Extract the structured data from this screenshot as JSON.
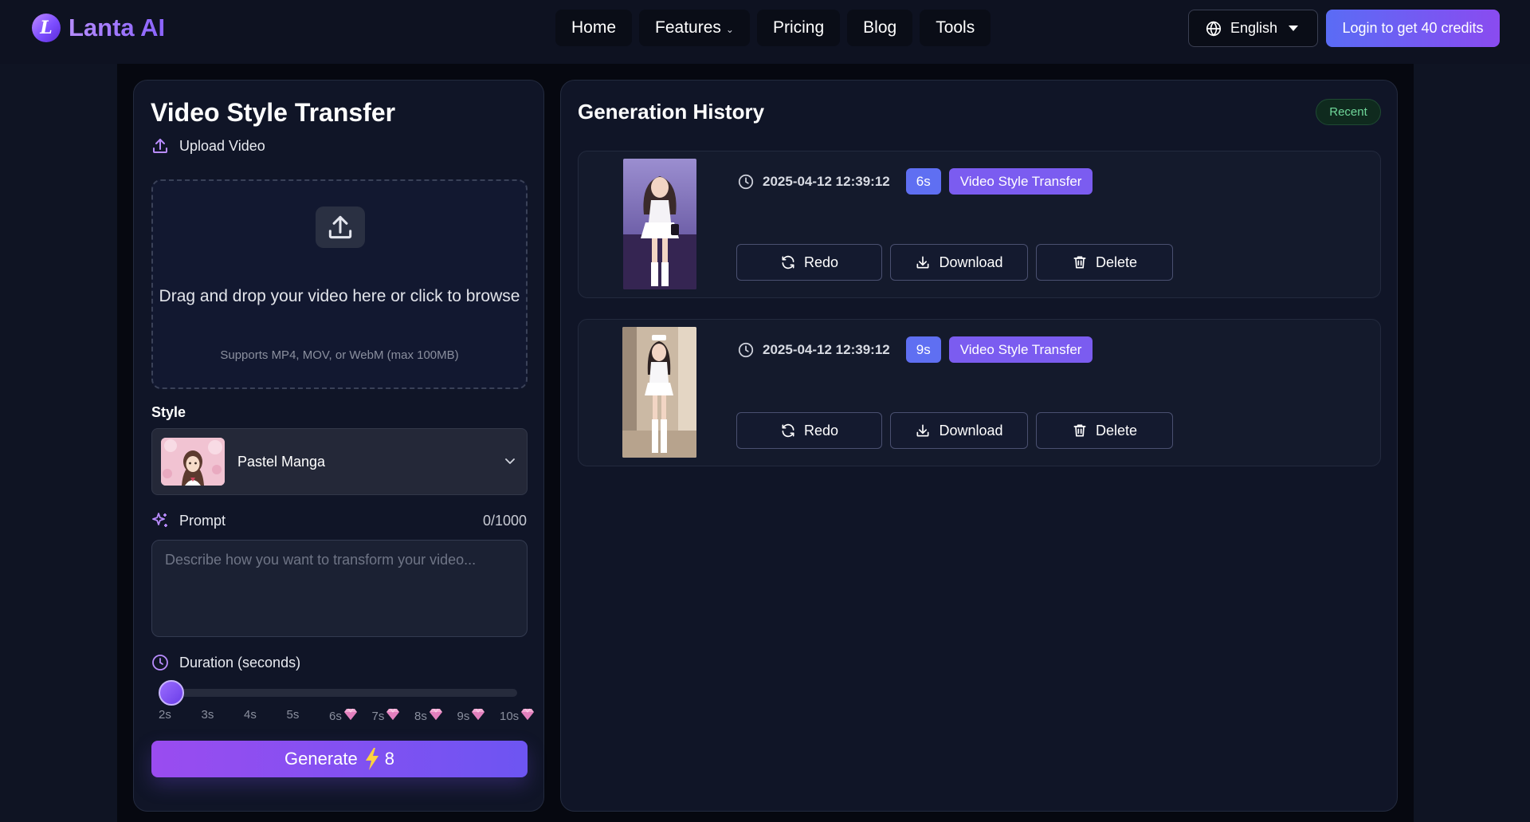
{
  "header": {
    "logo_letter": "L",
    "brand": "Lanta AI",
    "nav": [
      {
        "label": "Home"
      },
      {
        "label": "Features",
        "has_dropdown": true
      },
      {
        "label": "Pricing"
      },
      {
        "label": "Blog"
      },
      {
        "label": "Tools"
      }
    ],
    "language": "English",
    "login_label": "Login to get 40 credits"
  },
  "form": {
    "title": "Video Style Transfer",
    "upload": {
      "label": "Upload Video",
      "main_text": "Drag and drop your video here or click to browse",
      "sub_text": "Supports MP4, MOV, or WebM (max 100MB)"
    },
    "style": {
      "label": "Style",
      "selected": "Pastel Manga"
    },
    "prompt": {
      "label": "Prompt",
      "count": "0/1000",
      "placeholder": "Describe how you want to transform your video..."
    },
    "duration": {
      "label": "Duration (seconds)",
      "selected": "2s",
      "ticks": [
        {
          "label": "2s",
          "premium": false
        },
        {
          "label": "3s",
          "premium": false
        },
        {
          "label": "4s",
          "premium": false
        },
        {
          "label": "5s",
          "premium": false
        },
        {
          "label": "6s",
          "premium": true
        },
        {
          "label": "7s",
          "premium": true
        },
        {
          "label": "8s",
          "premium": true
        },
        {
          "label": "9s",
          "premium": true
        },
        {
          "label": "10s",
          "premium": true
        }
      ]
    },
    "generate": {
      "label": "Generate",
      "cost": "8"
    }
  },
  "history": {
    "title": "Generation History",
    "badge": "Recent",
    "items": [
      {
        "timestamp": "2025-04-12 12:39:12",
        "duration": "6s",
        "type": "Video Style Transfer"
      },
      {
        "timestamp": "2025-04-12 12:39:12",
        "duration": "9s",
        "type": "Video Style Transfer"
      }
    ],
    "actions": {
      "redo": "Redo",
      "download": "Download",
      "delete": "Delete"
    }
  },
  "colors": {
    "accent": "#7b5cf0",
    "duration_badge": "#5f6ff2",
    "recent_badge_text": "#6fd79a",
    "page_bg": "#0f1423"
  },
  "icons": {
    "upload": "upload-icon",
    "prompt": "sparkles-icon",
    "duration": "clock-icon",
    "premium": "diamond-icon",
    "generate": "lightning-icon",
    "language": "globe-icon",
    "redo": "refresh-icon",
    "download": "download-icon",
    "delete": "trash-icon"
  }
}
